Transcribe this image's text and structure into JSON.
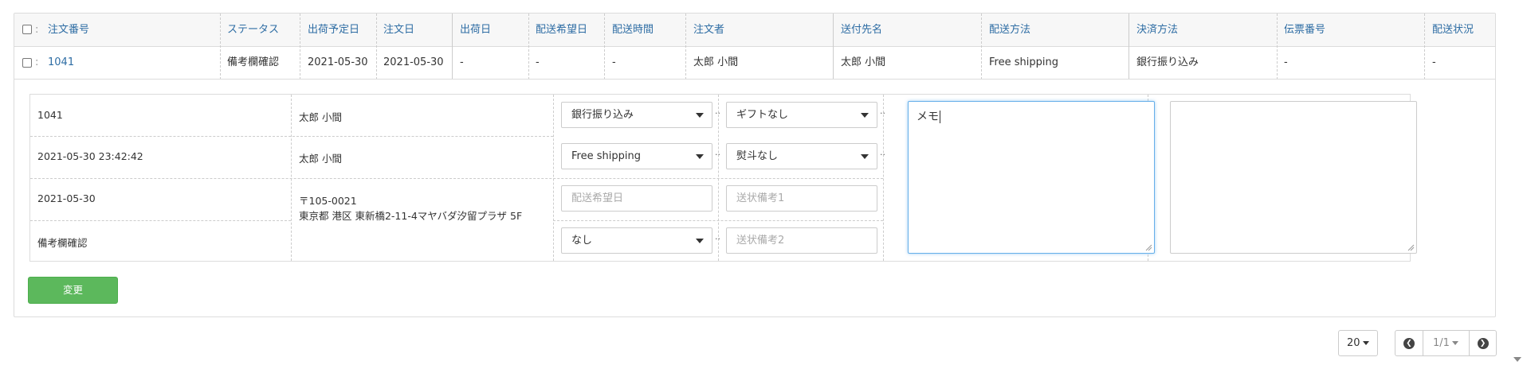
{
  "table": {
    "headers": [
      "注文番号",
      "ステータス",
      "出荷予定日",
      "注文日",
      "出荷日",
      "配送希望日",
      "配送時間",
      "注文者",
      "送付先名",
      "配送方法",
      "決済方法",
      "伝票番号",
      "配送状況"
    ],
    "row": {
      "order_no": "1041",
      "status": "備考欄確認",
      "ship_plan": "2021-05-30",
      "order_date": "2021-05-30",
      "ship_date": "-",
      "desired_date": "-",
      "delivery_time": "-",
      "orderer": "太郎 小間",
      "recipient": "太郎 小間",
      "shipping_method": "Free shipping",
      "payment_method": "銀行振り込み",
      "slip_no": "-",
      "delivery_status": "-"
    }
  },
  "detail": {
    "col1": [
      "1041",
      "2021-05-30 23:42:42",
      "2021-05-30",
      "備考欄確認"
    ],
    "col2": {
      "name1": "太郎 小間",
      "name2": "太郎 小間",
      "postal": "〒105-0021",
      "address": "東京都 港区 東新橋2-11-4マヤバダ汐留プラザ 5F"
    },
    "selects": {
      "payment": "銀行振り込み",
      "shipping": "Free shipping",
      "gift": "ギフトなし",
      "noshi": "熨斗なし",
      "time": "なし"
    },
    "placeholders": {
      "desired_date": "配送希望日",
      "note1": "送状備考1",
      "note2": "送状備考2"
    },
    "memo_value": "メモ",
    "memo2_value": ""
  },
  "actions": {
    "change_label": "変更"
  },
  "pagination": {
    "page_size": "20",
    "page_indicator": "1/1"
  }
}
